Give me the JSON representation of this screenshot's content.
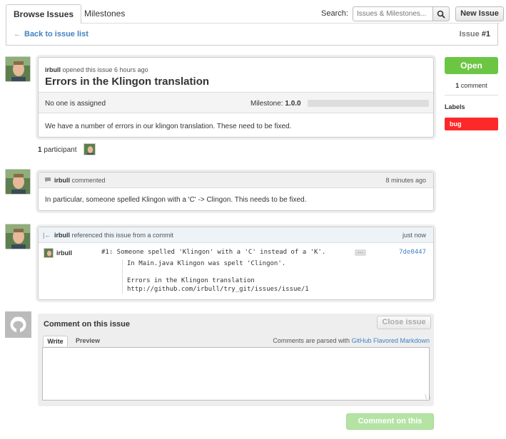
{
  "tabs": {
    "browse": "Browse Issues",
    "milestones": "Milestones"
  },
  "search": {
    "label": "Search:",
    "placeholder": "Issues & Milestones...",
    "new_issue": "New Issue"
  },
  "backbar": {
    "back_link": "Back to issue list",
    "issue_prefix": "Issue ",
    "issue_number": "#1"
  },
  "issue": {
    "opener_user": "irbull",
    "opener_text": " opened this issue 6 hours ago",
    "title": "Errors in the Klingon translation",
    "assignee": "No one is assigned",
    "milestone_label": "Milestone: ",
    "milestone_value": "1.0.0",
    "milestone_progress": 0,
    "body": "We have a number of errors in our klingon translation. These need to be fixed."
  },
  "participants": {
    "count": "1",
    "label": " participant"
  },
  "comment": {
    "user": "irbull",
    "action": " commented",
    "time": "8 minutes ago",
    "body": "In particular, someone spelled Klingon with a 'C' -> Clingon. This needs to be fixed."
  },
  "reference": {
    "user": "irbull",
    "action": " referenced this issue from a commit",
    "time": "just now",
    "commit_author": "irbull",
    "commit_message": "#1: Someone spelled 'Klingon' with a 'C' instead of a 'K'.",
    "commit_sha": "7de0447",
    "commit_body": [
      "In Main.java Klingon was spelt 'Clingon'.",
      "",
      "Errors in the Klingon translation",
      "http://github.com/irbull/try_git/issues/issue/1"
    ]
  },
  "new_comment": {
    "title": "Comment on this issue",
    "close_button": "Close issue",
    "tab_write": "Write",
    "tab_preview": "Preview",
    "md_note_prefix": "Comments are parsed with ",
    "md_note_link": "GitHub Flavored Markdown",
    "submit": "Comment on this issue"
  },
  "sidebar": {
    "state": "Open",
    "comment_count": "1",
    "comment_label": " comment",
    "labels_heading": "Labels",
    "labels": [
      "bug"
    ]
  },
  "colors": {
    "open_green": "#6cc644",
    "bug_red": "#fc2929",
    "link_blue": "#4183c4"
  },
  "icons": [
    "search-icon",
    "arrow-left-icon",
    "chat-bubble-icon",
    "commit-reference-icon",
    "github-octocat-icon",
    "resize-grip-icon"
  ]
}
